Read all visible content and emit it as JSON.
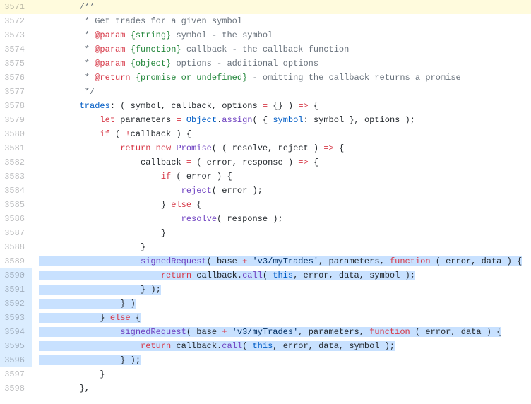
{
  "lines": [
    {
      "num": "3571",
      "hl": "yellow",
      "indent": "        ",
      "tokens": [
        {
          "t": "/**",
          "c": "k-comment"
        }
      ]
    },
    {
      "num": "3572",
      "indent": "        ",
      "tokens": [
        {
          "t": " * Get trades for a given symbol",
          "c": "k-comment"
        }
      ]
    },
    {
      "num": "3573",
      "indent": "        ",
      "tokens": [
        {
          "t": " * ",
          "c": "k-comment"
        },
        {
          "t": "@param",
          "c": "k-tag"
        },
        {
          "t": " ",
          "c": "k-comment"
        },
        {
          "t": "{string}",
          "c": "k-type"
        },
        {
          "t": " symbol - the symbol",
          "c": "k-comment"
        }
      ]
    },
    {
      "num": "3574",
      "indent": "        ",
      "tokens": [
        {
          "t": " * ",
          "c": "k-comment"
        },
        {
          "t": "@param",
          "c": "k-tag"
        },
        {
          "t": " ",
          "c": "k-comment"
        },
        {
          "t": "{function}",
          "c": "k-type"
        },
        {
          "t": " callback - the callback function",
          "c": "k-comment"
        }
      ]
    },
    {
      "num": "3575",
      "indent": "        ",
      "tokens": [
        {
          "t": " * ",
          "c": "k-comment"
        },
        {
          "t": "@param",
          "c": "k-tag"
        },
        {
          "t": " ",
          "c": "k-comment"
        },
        {
          "t": "{object}",
          "c": "k-type"
        },
        {
          "t": " options - additional options",
          "c": "k-comment"
        }
      ]
    },
    {
      "num": "3576",
      "indent": "        ",
      "tokens": [
        {
          "t": " * ",
          "c": "k-comment"
        },
        {
          "t": "@return",
          "c": "k-tag"
        },
        {
          "t": " ",
          "c": "k-comment"
        },
        {
          "t": "{promise or undefined}",
          "c": "k-type"
        },
        {
          "t": " - omitting the callback returns a promise",
          "c": "k-comment"
        }
      ]
    },
    {
      "num": "3577",
      "indent": "        ",
      "tokens": [
        {
          "t": " */",
          "c": "k-comment"
        }
      ]
    },
    {
      "num": "3578",
      "indent": "        ",
      "tokens": [
        {
          "t": "trades",
          "c": "k-key"
        },
        {
          "t": ": ( ",
          "c": "plain"
        },
        {
          "t": "symbol",
          "c": "plain"
        },
        {
          "t": ", ",
          "c": "plain"
        },
        {
          "t": "callback",
          "c": "plain"
        },
        {
          "t": ", ",
          "c": "plain"
        },
        {
          "t": "options",
          "c": "plain"
        },
        {
          "t": " ",
          "c": "plain"
        },
        {
          "t": "=",
          "c": "k-kw"
        },
        {
          "t": " {} ) ",
          "c": "plain"
        },
        {
          "t": "=>",
          "c": "k-kw"
        },
        {
          "t": " {",
          "c": "plain"
        }
      ]
    },
    {
      "num": "3579",
      "indent": "            ",
      "tokens": [
        {
          "t": "let",
          "c": "k-kw"
        },
        {
          "t": " parameters ",
          "c": "plain"
        },
        {
          "t": "=",
          "c": "k-kw"
        },
        {
          "t": " ",
          "c": "plain"
        },
        {
          "t": "Object",
          "c": "k-key"
        },
        {
          "t": ".",
          "c": "plain"
        },
        {
          "t": "assign",
          "c": "k-func"
        },
        {
          "t": "( { ",
          "c": "plain"
        },
        {
          "t": "symbol",
          "c": "k-key"
        },
        {
          "t": ": symbol }, options );",
          "c": "plain"
        }
      ]
    },
    {
      "num": "3580",
      "indent": "            ",
      "tokens": [
        {
          "t": "if",
          "c": "k-kw"
        },
        {
          "t": " ( ",
          "c": "plain"
        },
        {
          "t": "!",
          "c": "k-kw"
        },
        {
          "t": "callback ) {",
          "c": "plain"
        }
      ]
    },
    {
      "num": "3581",
      "indent": "                ",
      "tokens": [
        {
          "t": "return",
          "c": "k-kw"
        },
        {
          "t": " ",
          "c": "plain"
        },
        {
          "t": "new",
          "c": "k-kw"
        },
        {
          "t": " ",
          "c": "plain"
        },
        {
          "t": "Promise",
          "c": "k-id"
        },
        {
          "t": "( ( ",
          "c": "plain"
        },
        {
          "t": "resolve",
          "c": "plain"
        },
        {
          "t": ", ",
          "c": "plain"
        },
        {
          "t": "reject",
          "c": "plain"
        },
        {
          "t": " ) ",
          "c": "plain"
        },
        {
          "t": "=>",
          "c": "k-kw"
        },
        {
          "t": " {",
          "c": "plain"
        }
      ]
    },
    {
      "num": "3582",
      "indent": "                    ",
      "tokens": [
        {
          "t": "callback",
          "c": "plain"
        },
        {
          "t": " ",
          "c": "plain"
        },
        {
          "t": "=",
          "c": "k-kw"
        },
        {
          "t": " ( ",
          "c": "plain"
        },
        {
          "t": "error",
          "c": "plain"
        },
        {
          "t": ", ",
          "c": "plain"
        },
        {
          "t": "response",
          "c": "plain"
        },
        {
          "t": " ) ",
          "c": "plain"
        },
        {
          "t": "=>",
          "c": "k-kw"
        },
        {
          "t": " {",
          "c": "plain"
        }
      ]
    },
    {
      "num": "3583",
      "indent": "                        ",
      "tokens": [
        {
          "t": "if",
          "c": "k-kw"
        },
        {
          "t": " ( error ) {",
          "c": "plain"
        }
      ]
    },
    {
      "num": "3584",
      "indent": "                            ",
      "tokens": [
        {
          "t": "reject",
          "c": "k-func"
        },
        {
          "t": "( error );",
          "c": "plain"
        }
      ]
    },
    {
      "num": "3585",
      "indent": "                        ",
      "tokens": [
        {
          "t": "} ",
          "c": "plain"
        },
        {
          "t": "else",
          "c": "k-kw"
        },
        {
          "t": " {",
          "c": "plain"
        }
      ]
    },
    {
      "num": "3586",
      "indent": "                            ",
      "tokens": [
        {
          "t": "resolve",
          "c": "k-func"
        },
        {
          "t": "( response );",
          "c": "plain"
        }
      ]
    },
    {
      "num": "3587",
      "indent": "                        ",
      "tokens": [
        {
          "t": "}",
          "c": "plain"
        }
      ]
    },
    {
      "num": "3588",
      "indent": "                    ",
      "tokens": [
        {
          "t": "}",
          "c": "plain"
        }
      ]
    },
    {
      "num": "3589",
      "indent": "                    ",
      "sel": true,
      "tokens": [
        {
          "t": "signedRequest",
          "c": "k-func"
        },
        {
          "t": "( base ",
          "c": "plain"
        },
        {
          "t": "+",
          "c": "k-kw"
        },
        {
          "t": " ",
          "c": "plain"
        },
        {
          "t": "'v3/myTrades'",
          "c": "k-str"
        },
        {
          "t": ", parameters, ",
          "c": "plain"
        },
        {
          "t": "function",
          "c": "k-kw"
        },
        {
          "t": " ( ",
          "c": "plain"
        },
        {
          "t": "error",
          "c": "plain"
        },
        {
          "t": ", ",
          "c": "plain"
        },
        {
          "t": "data",
          "c": "plain"
        },
        {
          "t": " ) {",
          "c": "plain"
        }
      ]
    },
    {
      "num": "3590",
      "indent": "                        ",
      "sel": true,
      "gsel": true,
      "tokens": [
        {
          "t": "return",
          "c": "k-kw"
        },
        {
          "t": " callback.",
          "c": "plain"
        },
        {
          "t": "call",
          "c": "k-func"
        },
        {
          "t": "( ",
          "c": "plain"
        },
        {
          "t": "this",
          "c": "k-key"
        },
        {
          "t": ", error, data, symbol );",
          "c": "plain"
        }
      ]
    },
    {
      "num": "3591",
      "indent": "                    ",
      "sel": true,
      "gsel": true,
      "tokens": [
        {
          "t": "} );",
          "c": "plain"
        }
      ]
    },
    {
      "num": "3592",
      "indent": "                ",
      "sel": true,
      "gsel": true,
      "tokens": [
        {
          "t": "} )",
          "c": "plain"
        }
      ]
    },
    {
      "num": "3593",
      "indent": "            ",
      "sel": true,
      "gsel": true,
      "tokens": [
        {
          "t": "} ",
          "c": "plain"
        },
        {
          "t": "else",
          "c": "k-kw"
        },
        {
          "t": " {",
          "c": "plain"
        }
      ]
    },
    {
      "num": "3594",
      "indent": "                ",
      "sel": true,
      "gsel": true,
      "tokens": [
        {
          "t": "signedRequest",
          "c": "k-func"
        },
        {
          "t": "( base ",
          "c": "plain"
        },
        {
          "t": "+",
          "c": "k-kw"
        },
        {
          "t": " ",
          "c": "plain"
        },
        {
          "t": "'v3/myTrades'",
          "c": "k-str"
        },
        {
          "t": ", parameters, ",
          "c": "plain"
        },
        {
          "t": "function",
          "c": "k-kw"
        },
        {
          "t": " ( ",
          "c": "plain"
        },
        {
          "t": "error",
          "c": "plain"
        },
        {
          "t": ", ",
          "c": "plain"
        },
        {
          "t": "data",
          "c": "plain"
        },
        {
          "t": " ) {",
          "c": "plain"
        }
      ]
    },
    {
      "num": "3595",
      "indent": "                    ",
      "sel": true,
      "gsel": true,
      "tokens": [
        {
          "t": "return",
          "c": "k-kw"
        },
        {
          "t": " callback.",
          "c": "plain"
        },
        {
          "t": "call",
          "c": "k-func"
        },
        {
          "t": "( ",
          "c": "plain"
        },
        {
          "t": "this",
          "c": "k-key"
        },
        {
          "t": ", error, data, symbol );",
          "c": "plain"
        }
      ]
    },
    {
      "num": "3596",
      "indent": "                ",
      "sel": true,
      "gsel": true,
      "tokens": [
        {
          "t": "} );",
          "c": "plain"
        }
      ]
    },
    {
      "num": "3597",
      "indent": "            ",
      "tokens": [
        {
          "t": "}",
          "c": "plain"
        }
      ]
    },
    {
      "num": "3598",
      "indent": "        ",
      "tokens": [
        {
          "t": "},",
          "c": "plain"
        }
      ]
    }
  ]
}
